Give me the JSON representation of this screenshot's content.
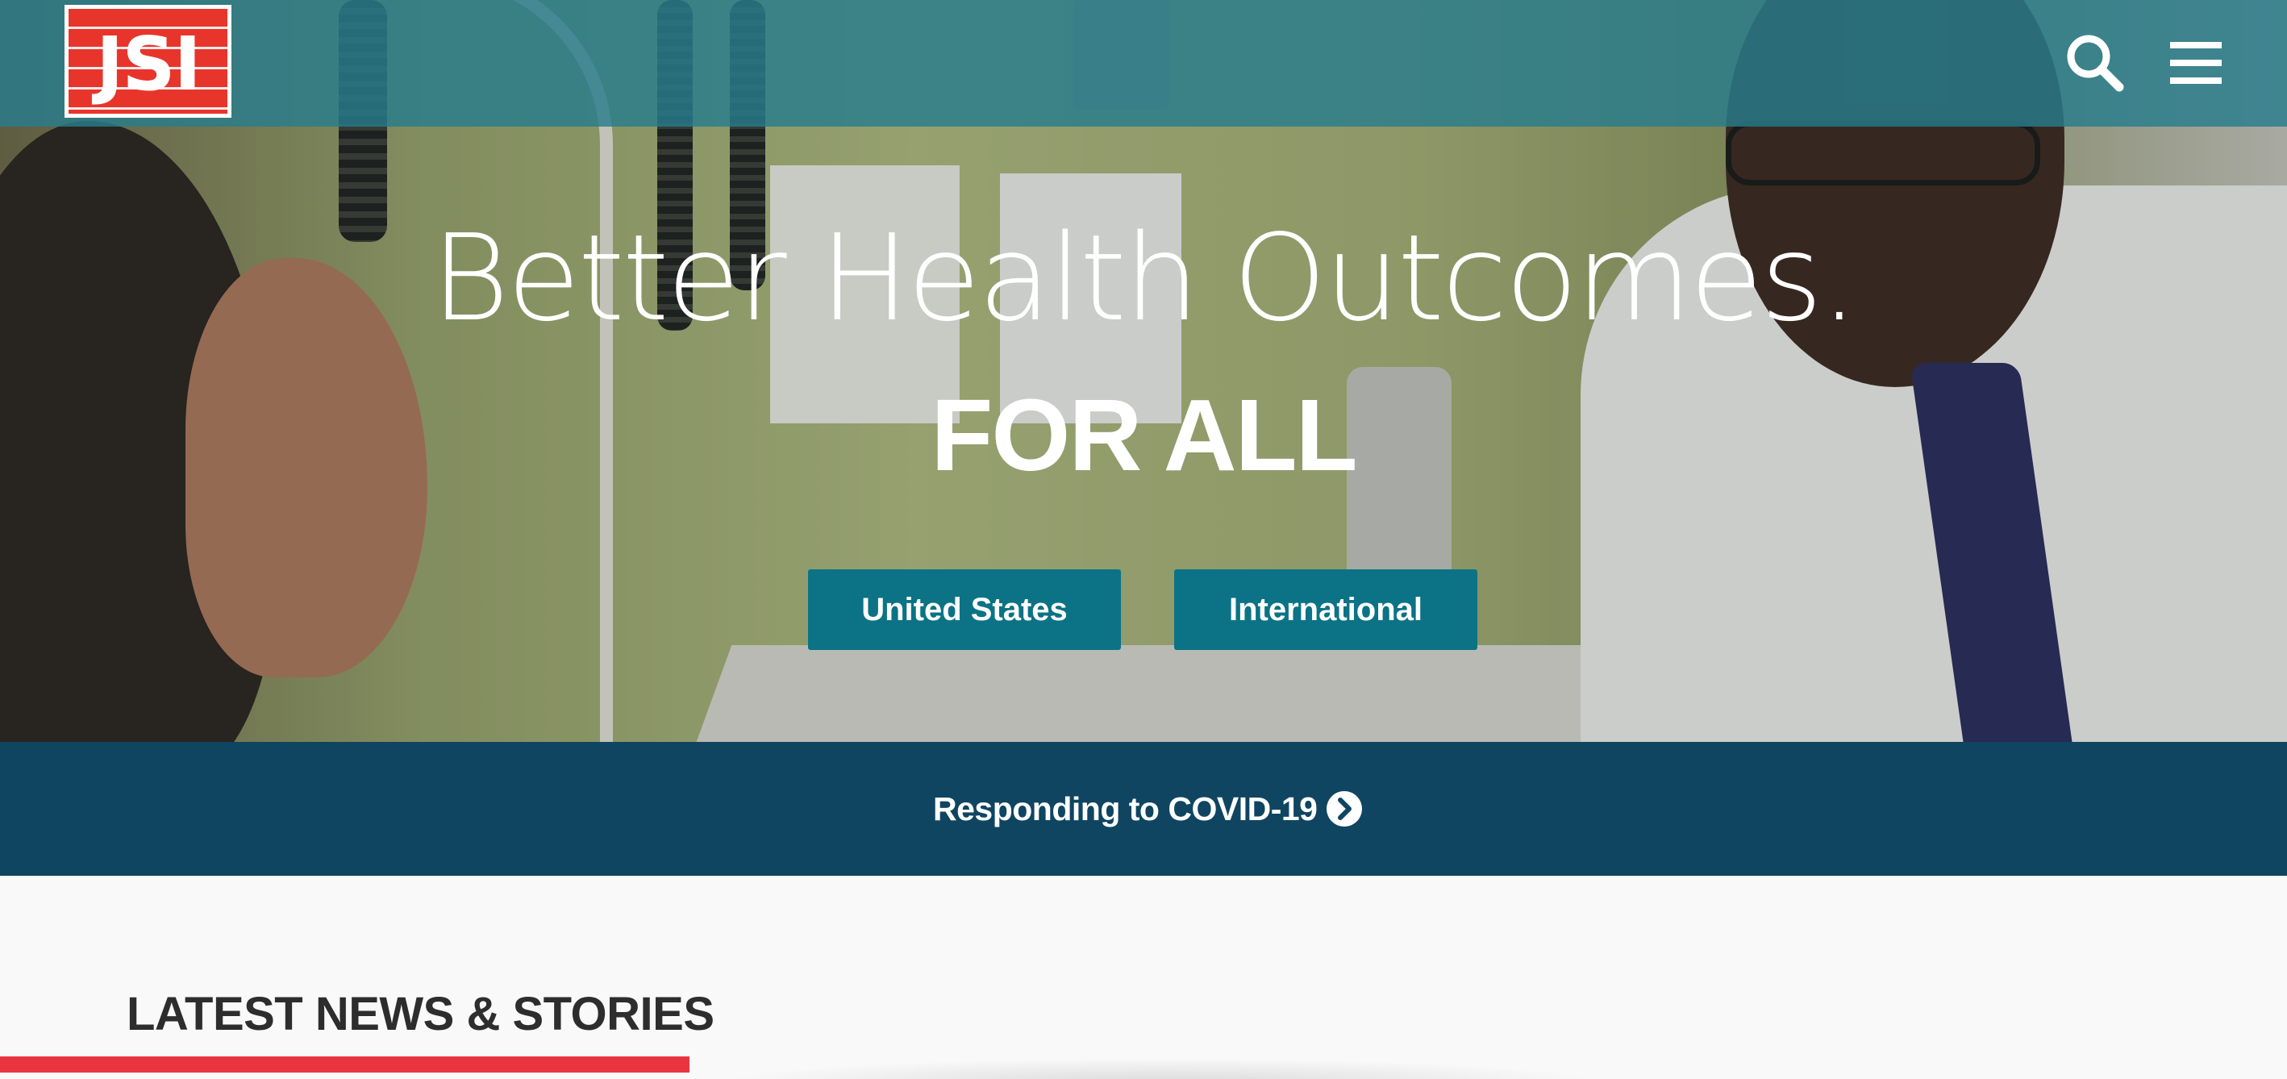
{
  "header": {
    "logo_text": "JSI",
    "search_icon": "search-icon",
    "menu_icon": "hamburger-menu-icon"
  },
  "hero": {
    "headline": "Better Health Outcomes.",
    "subheadline": "FOR ALL",
    "buttons": [
      {
        "label": "United States"
      },
      {
        "label": "International"
      }
    ]
  },
  "banner": {
    "text": "Responding to COVID-19",
    "icon": "chevron-right-circle-icon"
  },
  "news": {
    "title": "LATEST NEWS & STORIES"
  },
  "colors": {
    "topbar": "#287d8c",
    "button": "#0b7385",
    "banner": "#0f4561",
    "accent": "#e8353f",
    "logo": "#e8352c"
  }
}
